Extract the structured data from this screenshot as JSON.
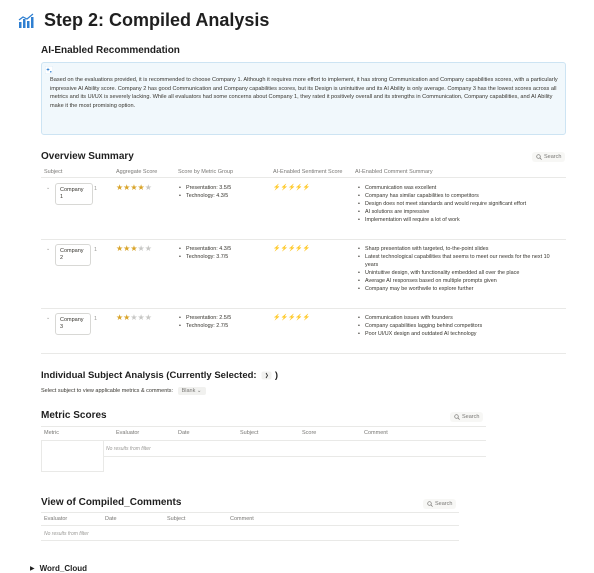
{
  "page": {
    "title": "Step 2: Compiled Analysis",
    "title_icon": "bar-chart-icon"
  },
  "recommendation": {
    "heading": "AI-Enabled Recommendation",
    "icon": "sparkles-icon",
    "text": "Based on the evaluations provided, it is recommended to choose Company 1. Although it requires more effort to implement, it has strong Communication and Company capabilities scores, with a particularly impressive AI Ability score. Company 2 has good Communication and Company capabilities scores, but its Design is unintuitive and its AI Ability is only average. Company 3 has the lowest scores across all metrics and its UI/UX is severely lacking. While all evaluators had some concerns about Company 1, they rated it positively overall and its strengths in Communication, Company capabilities, and AI Ability make it the most promising option."
  },
  "overview": {
    "heading": "Overview Summary",
    "search_label": "Search",
    "columns": [
      "Subject",
      "Aggregate Score",
      "Score by Metric Group",
      "AI-Enabled Sentiment Score",
      "AI-Enabled Comment Summary"
    ],
    "rows": [
      {
        "subject": "Company 1",
        "count": "1",
        "stars": 4,
        "metrics": [
          "Presentation: 3.5/5",
          "Technology: 4.3/5"
        ],
        "sentiment": 3,
        "comments": [
          "Communication was excellent",
          "Company has similar capabilities to competitors",
          "Design does not meet standards and would require significant effort",
          "AI solutions are impressive",
          "Implementation will require a lot of work"
        ]
      },
      {
        "subject": "Company 2",
        "count": "1",
        "stars": 3,
        "metrics": [
          "Presentation: 4.3/5",
          "Technology: 3.7/5"
        ],
        "sentiment": 2,
        "comments": [
          "Sharp presentation with targeted, to-the-point slides",
          "Latest technological capabilities that seems to meet our needs for the next 10 years",
          "Unintuitive design, with functionality embedded all over the place",
          "Average AI responses based on multiple prompts given",
          "Company may be worthwile to explore further"
        ]
      },
      {
        "subject": "Company 3",
        "count": "1",
        "stars": 2,
        "metrics": [
          "Presentation: 2.5/5",
          "Technology: 2.7/5"
        ],
        "sentiment": 2,
        "comments": [
          "Communication issues with founders",
          "Company capabilities lagging behind competitors",
          "Poor UI/UX design and outdated AI technology"
        ]
      }
    ],
    "colors": {
      "star": "#d9a42a",
      "sentiment": "#e1582a"
    }
  },
  "individual": {
    "heading": "Individual Subject Analysis (Currently Selected:",
    "heading_end": ")",
    "prompt": "Select subject to view applicable metrics & comments:",
    "selected_value": "Blank"
  },
  "metric_scores": {
    "heading": "Metric Scores",
    "search_label": "Search",
    "columns": [
      "Metric",
      "Evaluator",
      "Date",
      "Subject",
      "Score",
      "Comment"
    ],
    "empty_text": "No results from filter"
  },
  "compiled_comments": {
    "heading": "View of Compiled_Comments",
    "search_label": "Search",
    "columns": [
      "Evaluator",
      "Date",
      "Subject",
      "Comment"
    ],
    "empty_text": "No results from filter"
  },
  "word_cloud": {
    "label": "Word_Cloud"
  }
}
